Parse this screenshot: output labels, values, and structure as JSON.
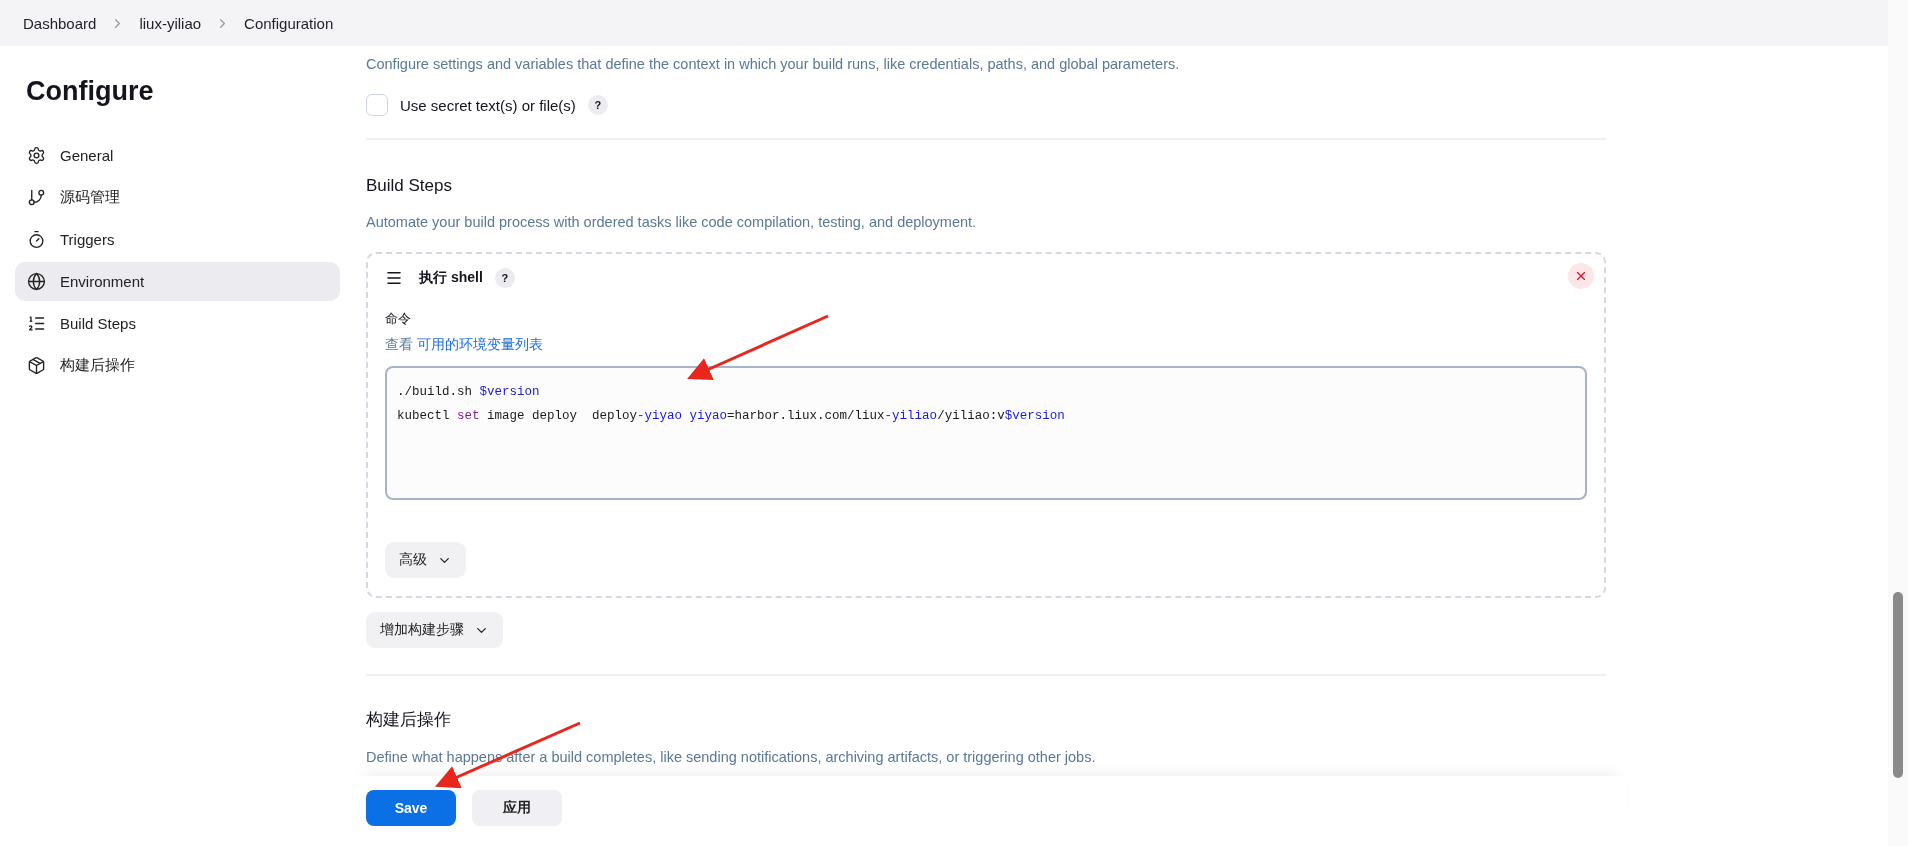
{
  "breadcrumb": [
    {
      "label": "Dashboard"
    },
    {
      "label": "liux-yiliao"
    },
    {
      "label": "Configuration"
    }
  ],
  "sidebar": {
    "title": "Configure",
    "items": [
      {
        "label": "General",
        "selected": false
      },
      {
        "label": "源码管理",
        "selected": false
      },
      {
        "label": "Triggers",
        "selected": false
      },
      {
        "label": "Environment",
        "selected": true
      },
      {
        "label": "Build Steps",
        "selected": false
      },
      {
        "label": "构建后操作",
        "selected": false
      }
    ]
  },
  "environment": {
    "description": "Configure settings and variables that define the context in which your build runs, like credentials, paths, and global parameters.",
    "secret_checkbox": {
      "label": "Use secret text(s) or file(s)",
      "checked": false,
      "help": "?"
    }
  },
  "build_steps": {
    "title": "Build Steps",
    "description": "Automate your build process with ordered tasks like code compilation, testing, and deployment.",
    "step": {
      "title": "执行 shell",
      "help": "?",
      "command_label": "命令",
      "link_prefix": "查看",
      "link": "可用的环境变量列表",
      "code_lines": [
        [
          {
            "text": "./build.sh ",
            "kind": "plain"
          },
          {
            "text": "$version",
            "kind": "variable"
          }
        ],
        [
          {
            "text": "kubectl ",
            "kind": "plain"
          },
          {
            "text": "set",
            "kind": "keyword"
          },
          {
            "text": " image deploy  deploy",
            "kind": "plain"
          },
          {
            "text": "-yiyao yiyao",
            "kind": "variable"
          },
          {
            "text": "=harbor.liux.com/liux",
            "kind": "plain"
          },
          {
            "text": "-yiliao",
            "kind": "variable"
          },
          {
            "text": "/yiliao:v",
            "kind": "plain"
          },
          {
            "text": "$version",
            "kind": "variable"
          }
        ]
      ],
      "advanced_button": "高级"
    },
    "add_button": "增加构建步骤"
  },
  "post_build": {
    "title": "构建后操作",
    "description": "Define what happens after a build completes, like sending notifications, archiving artifacts, or triggering other jobs."
  },
  "footer": {
    "buttons": [
      {
        "label": "Save",
        "kind": "primary"
      },
      {
        "label": "应用",
        "kind": "secondary"
      }
    ]
  }
}
